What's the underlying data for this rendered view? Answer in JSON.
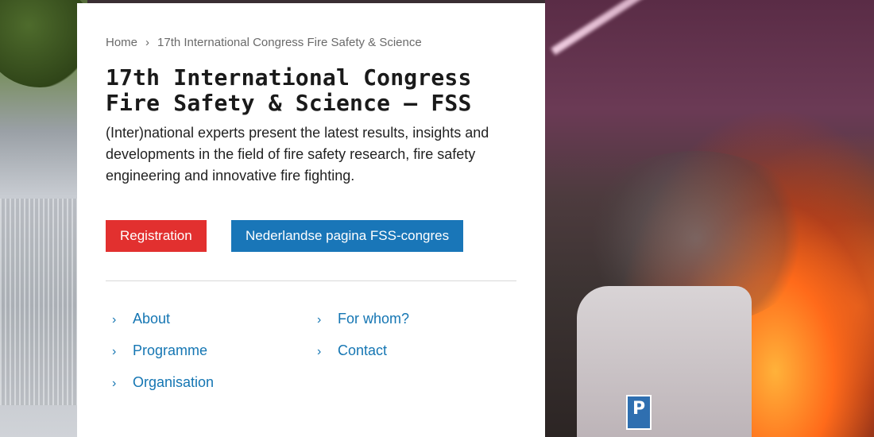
{
  "breadcrumb": {
    "home": "Home",
    "separator": "›",
    "current": "17th International Congress Fire Safety & Science"
  },
  "page": {
    "title_line1": "17th International Congress",
    "title_line2": "Fire Safety & Science – FSS",
    "intro": "(Inter)national experts present the latest results, insights and developments in the field of fire safety research, fire safety engineering and innovative fire fighting."
  },
  "buttons": {
    "registration": "Registration",
    "dutch_page": "Nederlandse pagina FSS-congres"
  },
  "links": {
    "chevron": "›",
    "about": "About",
    "for_whom": "For whom?",
    "programme": "Programme",
    "contact": "Contact",
    "organisation": "Organisation"
  },
  "photo": {
    "parking_sign": "P"
  },
  "colors": {
    "registration_bg": "#e2302f",
    "dutch_page_bg": "#1976b8",
    "link_color": "#1576b3"
  }
}
